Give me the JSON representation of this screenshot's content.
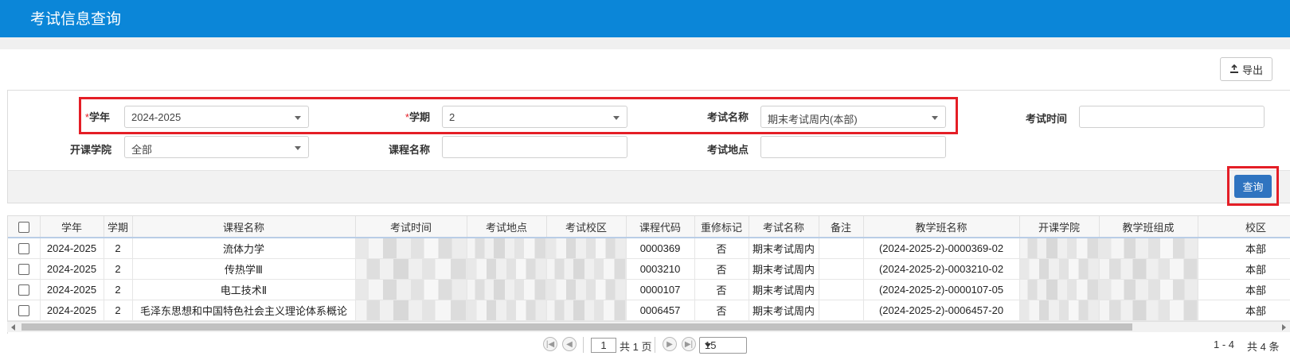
{
  "header": {
    "title": "考试信息查询"
  },
  "toolbar": {
    "export_label": "导出"
  },
  "filters": {
    "year_label": "学年",
    "year_value": "2024-2025",
    "term_label": "学期",
    "term_value": "2",
    "exam_name_label": "考试名称",
    "exam_name_value": "期末考试周内(本部)",
    "exam_time_label": "考试时间",
    "exam_time_value": "",
    "college_label": "开课学院",
    "college_value": "全部",
    "course_name_label": "课程名称",
    "course_name_value": "",
    "exam_place_label": "考试地点",
    "exam_place_value": "",
    "required_mark": "*"
  },
  "actions": {
    "query_label": "查询"
  },
  "table": {
    "columns": [
      "学年",
      "学期",
      "课程名称",
      "考试时间",
      "考试地点",
      "考试校区",
      "课程代码",
      "重修标记",
      "考试名称",
      "备注",
      "教学班名称",
      "开课学院",
      "教学班组成",
      "校区"
    ],
    "rows": [
      {
        "year": "2024-2025",
        "term": "2",
        "course": "流体力学",
        "code": "0000369",
        "retake": "否",
        "exam": "期末考试周内",
        "note": "",
        "class": "(2024-2025-2)-0000369-02",
        "campus": "本部"
      },
      {
        "year": "2024-2025",
        "term": "2",
        "course": "传热学Ⅲ",
        "code": "0003210",
        "retake": "否",
        "exam": "期末考试周内",
        "note": "",
        "class": "(2024-2025-2)-0003210-02",
        "campus": "本部"
      },
      {
        "year": "2024-2025",
        "term": "2",
        "course": "电工技术Ⅱ",
        "code": "0000107",
        "retake": "否",
        "exam": "期末考试周内",
        "note": "",
        "class": "(2024-2025-2)-0000107-05",
        "campus": "本部"
      },
      {
        "year": "2024-2025",
        "term": "2",
        "course": "毛泽东思想和中国特色社会主义理论体系概论",
        "code": "0006457",
        "retake": "否",
        "exam": "期末考试周内",
        "note": "",
        "class": "(2024-2025-2)-0006457-20",
        "campus": "本部"
      }
    ]
  },
  "pager": {
    "page": "1",
    "total_pages_text": "共 1 页",
    "page_size": "15",
    "range_text": "1 - 4",
    "total_text": "共 4 条"
  },
  "colors": {
    "header_bg": "#0b86d8",
    "highlight": "#e41e26",
    "query_btn": "#2f74c0"
  }
}
